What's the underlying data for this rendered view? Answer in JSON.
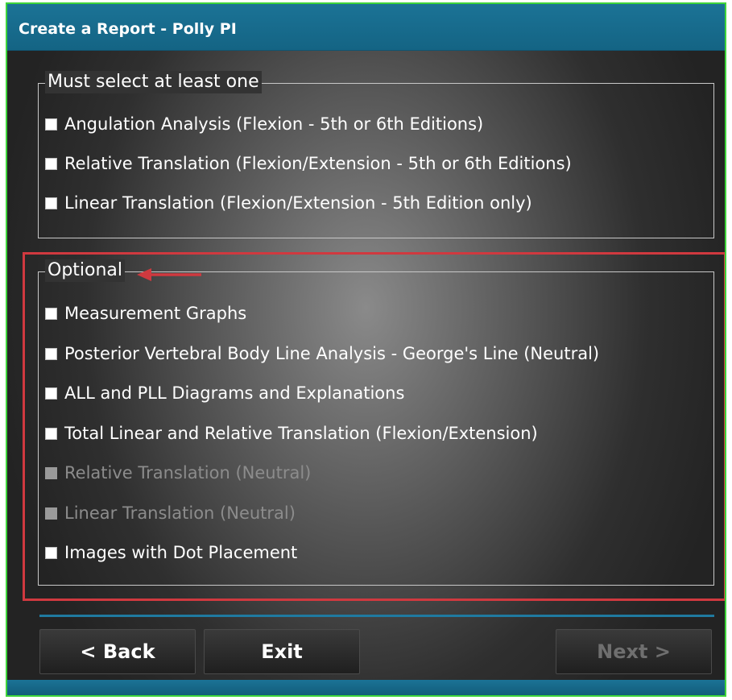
{
  "window": {
    "title": "Create a Report - Polly PI"
  },
  "required_group": {
    "legend": "Must select at least one",
    "options": [
      {
        "label": "Angulation Analysis (Flexion - 5th or 6th Editions)",
        "checked": false,
        "enabled": true
      },
      {
        "label": "Relative Translation (Flexion/Extension - 5th or 6th Editions)",
        "checked": false,
        "enabled": true
      },
      {
        "label": "Linear Translation (Flexion/Extension - 5th Edition only)",
        "checked": false,
        "enabled": true
      }
    ]
  },
  "optional_group": {
    "legend": "Optional",
    "options": [
      {
        "label": "Measurement Graphs",
        "checked": false,
        "enabled": true
      },
      {
        "label": "Posterior Vertebral Body Line Analysis - George's Line (Neutral)",
        "checked": false,
        "enabled": true
      },
      {
        "label": "ALL and PLL Diagrams and Explanations",
        "checked": false,
        "enabled": true
      },
      {
        "label": "Total Linear and Relative Translation (Flexion/Extension)",
        "checked": false,
        "enabled": true
      },
      {
        "label": "Relative Translation (Neutral)",
        "checked": false,
        "enabled": false
      },
      {
        "label": "Linear Translation (Neutral)",
        "checked": false,
        "enabled": false
      },
      {
        "label": "Images with Dot Placement",
        "checked": false,
        "enabled": true
      }
    ]
  },
  "buttons": {
    "back_label": "< Back",
    "exit_label": "Exit",
    "next_label": "Next >",
    "next_enabled": false
  },
  "colors": {
    "titlebar": "#146484",
    "window_border": "#3ed43a",
    "highlight": "#d0393f",
    "separator": "#1f7aa0"
  }
}
